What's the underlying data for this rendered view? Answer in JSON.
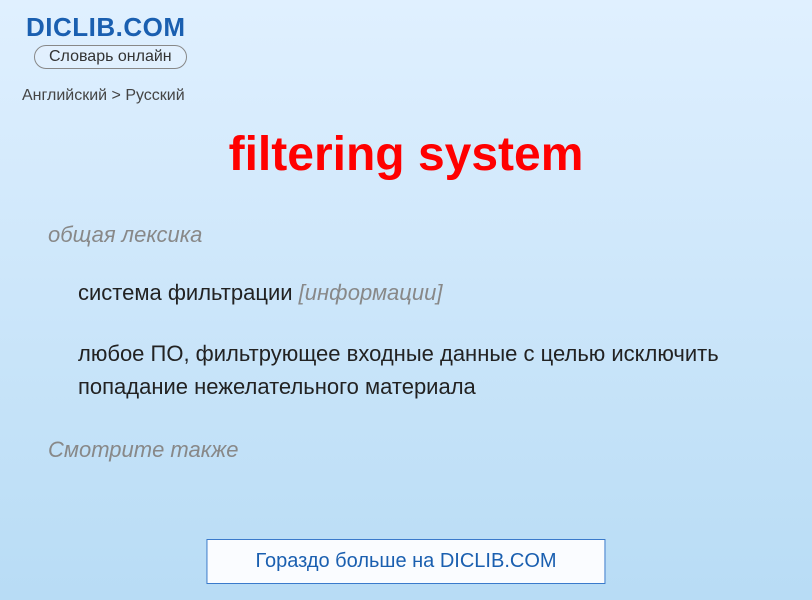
{
  "header": {
    "site_name": "DICLIB.COM",
    "subtitle": "Словарь онлайн"
  },
  "breadcrumb": "Английский > Русский",
  "entry": {
    "title": "filtering system",
    "category": "общая лексика",
    "definitions": [
      {
        "text": "система фильтрации ",
        "bracket": "[информации]"
      },
      {
        "text": "любое ПО, фильтрующее входные данные с целью исключить попадание нежелательного материала",
        "bracket": ""
      }
    ],
    "see_also_label": "Смотрите также"
  },
  "footer": {
    "more_link": "Гораздо больше на DICLIB.COM"
  }
}
